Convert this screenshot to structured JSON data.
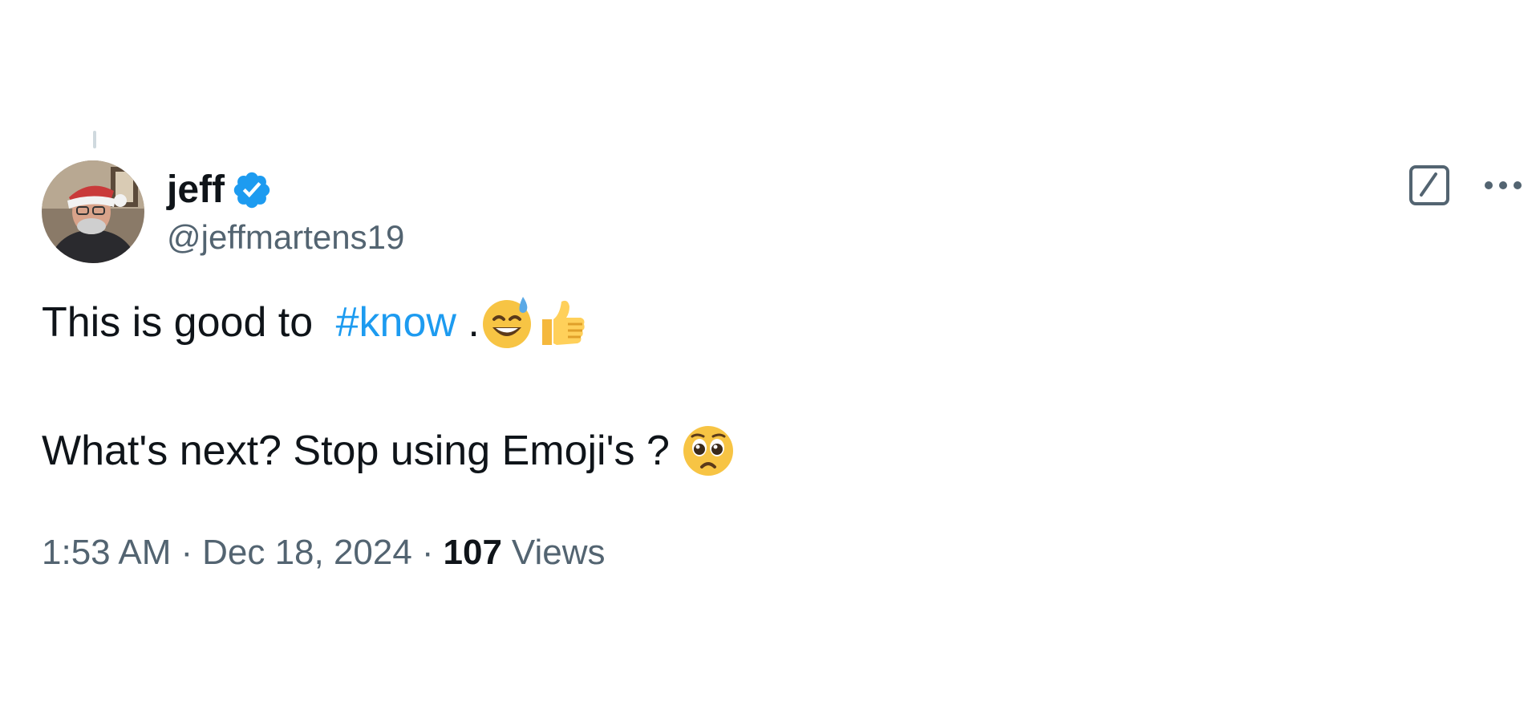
{
  "tweet": {
    "author": {
      "display_name": "jeff",
      "handle": "@jeffmartens19",
      "verified": true,
      "avatar_icon": "profile-photo"
    },
    "text": {
      "line1_prefix": "This is good to ",
      "hashtag": "#know",
      "line1_suffix": " .",
      "line1_emojis": [
        "sweat-smile-emoji",
        "thumbs-up-emoji"
      ],
      "line2": "What's next? Stop using Emoji's ? ",
      "line2_emoji": "pleading-face-emoji"
    },
    "meta": {
      "time": "1:53 AM",
      "separator": "·",
      "date": "Dec 18, 2024",
      "views_count": "107",
      "views_label": "Views"
    },
    "actions": {
      "grok_icon": "grok-icon",
      "more_icon": "more-options-icon"
    }
  },
  "colors": {
    "text_primary": "#0f1419",
    "text_secondary": "#536471",
    "link": "#1d9bf0",
    "verified": "#1d9bf0"
  }
}
